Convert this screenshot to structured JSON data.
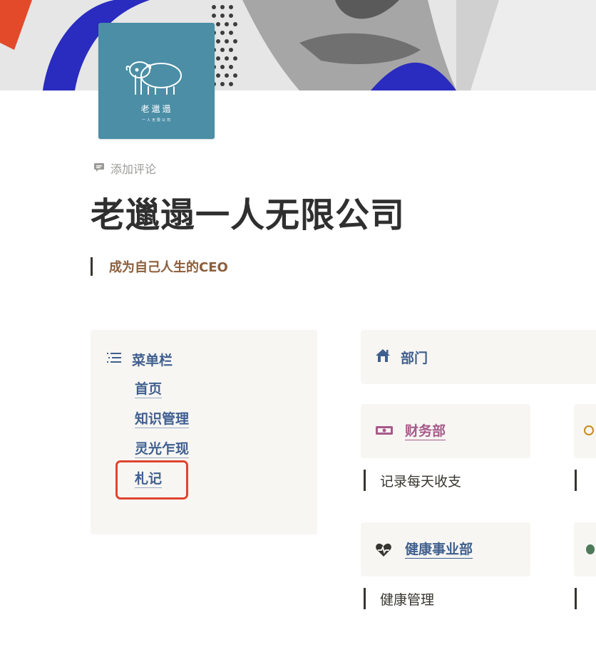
{
  "page": {
    "logo": {
      "brand_text": "老邋遢",
      "sub_text": "一人无限公司"
    },
    "add_comment_label": "添加评论",
    "title": "老邋遢一人无限公司",
    "quote": "成为自己人生的CEO"
  },
  "menu": {
    "heading": "菜单栏",
    "items": [
      {
        "label": "首页"
      },
      {
        "label": "知识管理"
      },
      {
        "label": "灵光乍现"
      },
      {
        "label": "札记"
      }
    ],
    "highlighted_item": "札记"
  },
  "departments": {
    "heading": "部门",
    "cards": [
      {
        "label": "财务部",
        "description": "记录每天收支",
        "icon": "money-icon",
        "color": "#a85a8a"
      },
      {
        "label": "健康事业部",
        "description": "健康管理",
        "icon": "heart-pulse-icon",
        "color": "#3f5f8f"
      }
    ]
  },
  "colors": {
    "accent_blue": "#3f5f8f",
    "logo_teal": "#4b8ea6",
    "quote_brown": "#8b5e3c",
    "highlight_red": "#e0442f",
    "finance_pink": "#a85a8a"
  }
}
